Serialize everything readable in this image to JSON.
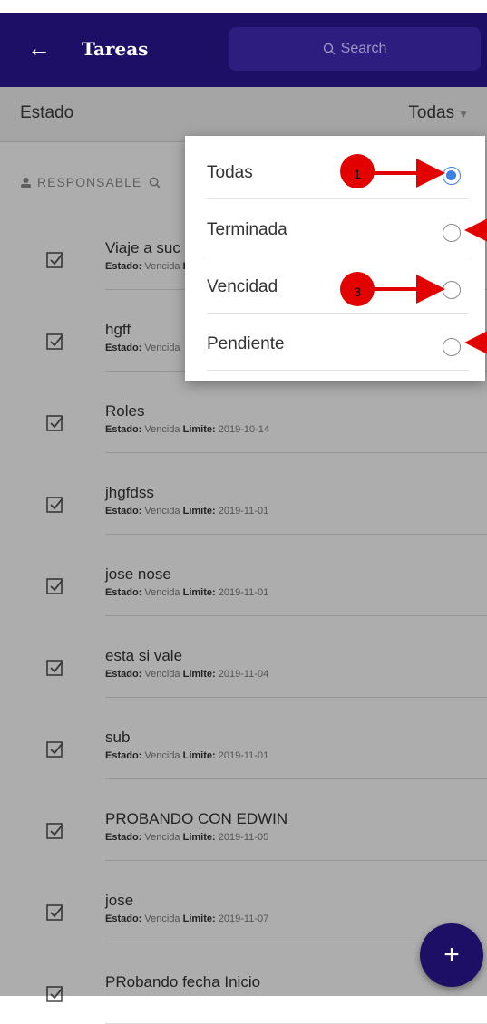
{
  "header": {
    "title": "Tareas",
    "search_placeholder": "Search"
  },
  "filter": {
    "estado_label": "Estado",
    "selected": "Todas"
  },
  "responsable": {
    "label": "RESPONSABLE"
  },
  "tasks": [
    {
      "name": "Viaje a suc",
      "estado_key": "Estado:",
      "estado": "Vencida",
      "limite_key": "Limite:",
      "limite": ""
    },
    {
      "name": "hgff",
      "estado_key": "Estado:",
      "estado": "Vencida",
      "limite_key": "",
      "limite": ""
    },
    {
      "name": "Roles",
      "estado_key": "Estado:",
      "estado": "Vencida",
      "limite_key": "Limite:",
      "limite": "2019-10-14"
    },
    {
      "name": "jhgfdss",
      "estado_key": "Estado:",
      "estado": "Vencida",
      "limite_key": "Limite:",
      "limite": "2019-11-01"
    },
    {
      "name": "jose nose",
      "estado_key": "Estado:",
      "estado": "Vencida",
      "limite_key": "Limite:",
      "limite": "2019-11-01"
    },
    {
      "name": "esta si vale",
      "estado_key": "Estado:",
      "estado": "Vencida",
      "limite_key": "Limite:",
      "limite": "2019-11-04"
    },
    {
      "name": "sub",
      "estado_key": "Estado:",
      "estado": "Vencida",
      "limite_key": "Limite:",
      "limite": "2019-11-01"
    },
    {
      "name": "PROBANDO CON EDWIN",
      "estado_key": "Estado:",
      "estado": "Vencida",
      "limite_key": "Limite:",
      "limite": "2019-11-05"
    },
    {
      "name": "jose",
      "estado_key": "Estado:",
      "estado": "Vencida",
      "limite_key": "Limite:",
      "limite": "2019-11-07"
    },
    {
      "name": "PRobando fecha Inicio",
      "estado_key": "",
      "estado": "",
      "limite_key": "",
      "limite": ""
    }
  ],
  "menu": {
    "options": [
      {
        "label": "Todas",
        "selected": true
      },
      {
        "label": "Terminada",
        "selected": false
      },
      {
        "label": "Vencidad",
        "selected": false
      },
      {
        "label": "Pendiente",
        "selected": false
      }
    ]
  },
  "markers": [
    "1",
    "3"
  ],
  "fab": {
    "icon": "plus-icon",
    "label": "+"
  },
  "colors": {
    "appbar": "#1e0f66",
    "radio_selected": "#3d7fe3",
    "marker": "#e30000"
  }
}
